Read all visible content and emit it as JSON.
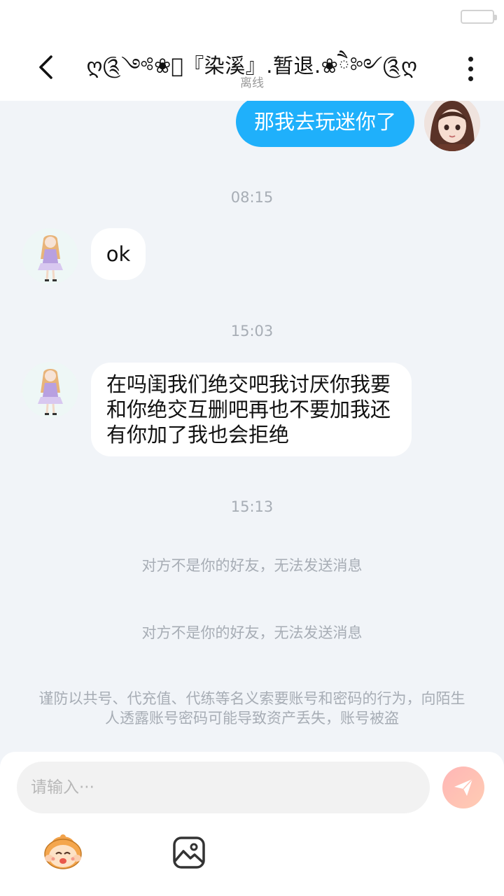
{
  "header": {
    "title": "ღ༊༺❀ཻ『染溪』.暂退.❀ཻ༻༊ღ",
    "status": "离线"
  },
  "messages": {
    "outgoing_1": "那我去玩迷你了",
    "time_1": "08:15",
    "incoming_1": "ok",
    "time_2": "15:03",
    "incoming_2": "在吗闺我们绝交吧我讨厌你我要和你绝交互删吧再也不要加我还有你加了我也会拒绝",
    "time_3": "15:13",
    "system_1": "对方不是你的好友，无法发送消息",
    "system_2": "对方不是你的好友，无法发送消息",
    "warning": "谨防以共号、代充值、代练等名义索要账号和密码的行为，向陌生人透露账号密码可能导致资产丢失，账号被盗"
  },
  "composer": {
    "placeholder": "请输入···"
  },
  "icons": {
    "back": "chevron-left-icon",
    "more": "more-vertical-icon",
    "send": "paper-plane-icon",
    "emoji": "emoji-face-icon",
    "image": "image-icon"
  },
  "colors": {
    "outgoing_bubble": "#1fb0fb",
    "send_button": "#ffbdb5",
    "background": "#f1f4f8"
  }
}
